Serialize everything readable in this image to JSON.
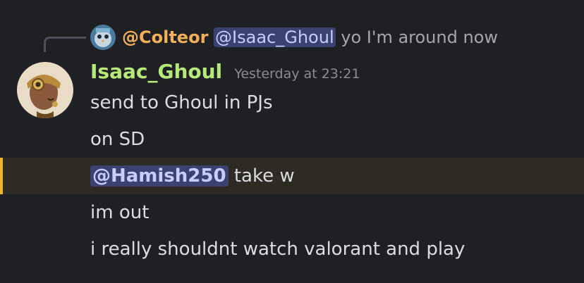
{
  "reply": {
    "author": "@Colteor",
    "mention": "@Isaac_Ghoul",
    "text": "yo I'm around now",
    "avatar_icon": "bird-avatar-icon"
  },
  "message": {
    "author": "Isaac_Ghoul",
    "timestamp": "Yesterday at 23:21",
    "avatar_icon": "steampunk-character-avatar",
    "colors": {
      "author": "#b6e87a",
      "reply_author": "#f3b05a",
      "mention_bg": "#3c4270",
      "highlight_bar": "#f0b232"
    },
    "lines": [
      {
        "text": "send to Ghoul in PJs"
      },
      {
        "text": "on SD"
      },
      {
        "mention": "@Hamish250",
        "text": " take w"
      },
      {
        "text": "im out"
      },
      {
        "text": "i really shouldnt watch valorant and play"
      }
    ]
  }
}
